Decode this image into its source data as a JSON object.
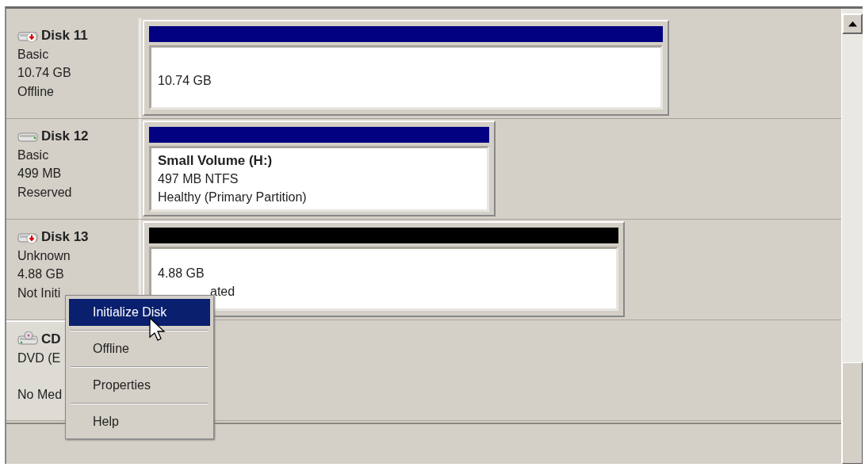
{
  "disks": [
    {
      "kind": "disk",
      "error": true,
      "name": "Disk 11",
      "type": "Basic",
      "size": "10.74 GB",
      "status": "Offline",
      "partition": {
        "color": "#000080",
        "lines": [
          "10.74 GB"
        ]
      }
    },
    {
      "kind": "disk",
      "error": false,
      "name": "Disk 12",
      "type": "Basic",
      "size": "499 MB",
      "status": "Reserved",
      "partition": {
        "color": "#000080",
        "title": "Small Volume  (H:)",
        "lines": [
          "497 MB NTFS",
          "Healthy (Primary Partition)"
        ]
      }
    },
    {
      "kind": "disk",
      "error": true,
      "name": "Disk 13",
      "type": "Unknown",
      "size": "4.88 GB",
      "status": "Not Initi",
      "partition": {
        "color": "#000000",
        "lines": [
          "4.88 GB",
          "ated"
        ]
      }
    },
    {
      "kind": "cdrom",
      "error": false,
      "name": "CD",
      "type": "DVD (E",
      "status": "No Med"
    }
  ],
  "context_menu": {
    "items": [
      {
        "label": "Initialize Disk",
        "selected": true
      },
      {
        "label": "Offline",
        "selected": false
      },
      {
        "label": "Properties",
        "selected": false
      },
      {
        "label": "Help",
        "selected": false
      }
    ]
  }
}
